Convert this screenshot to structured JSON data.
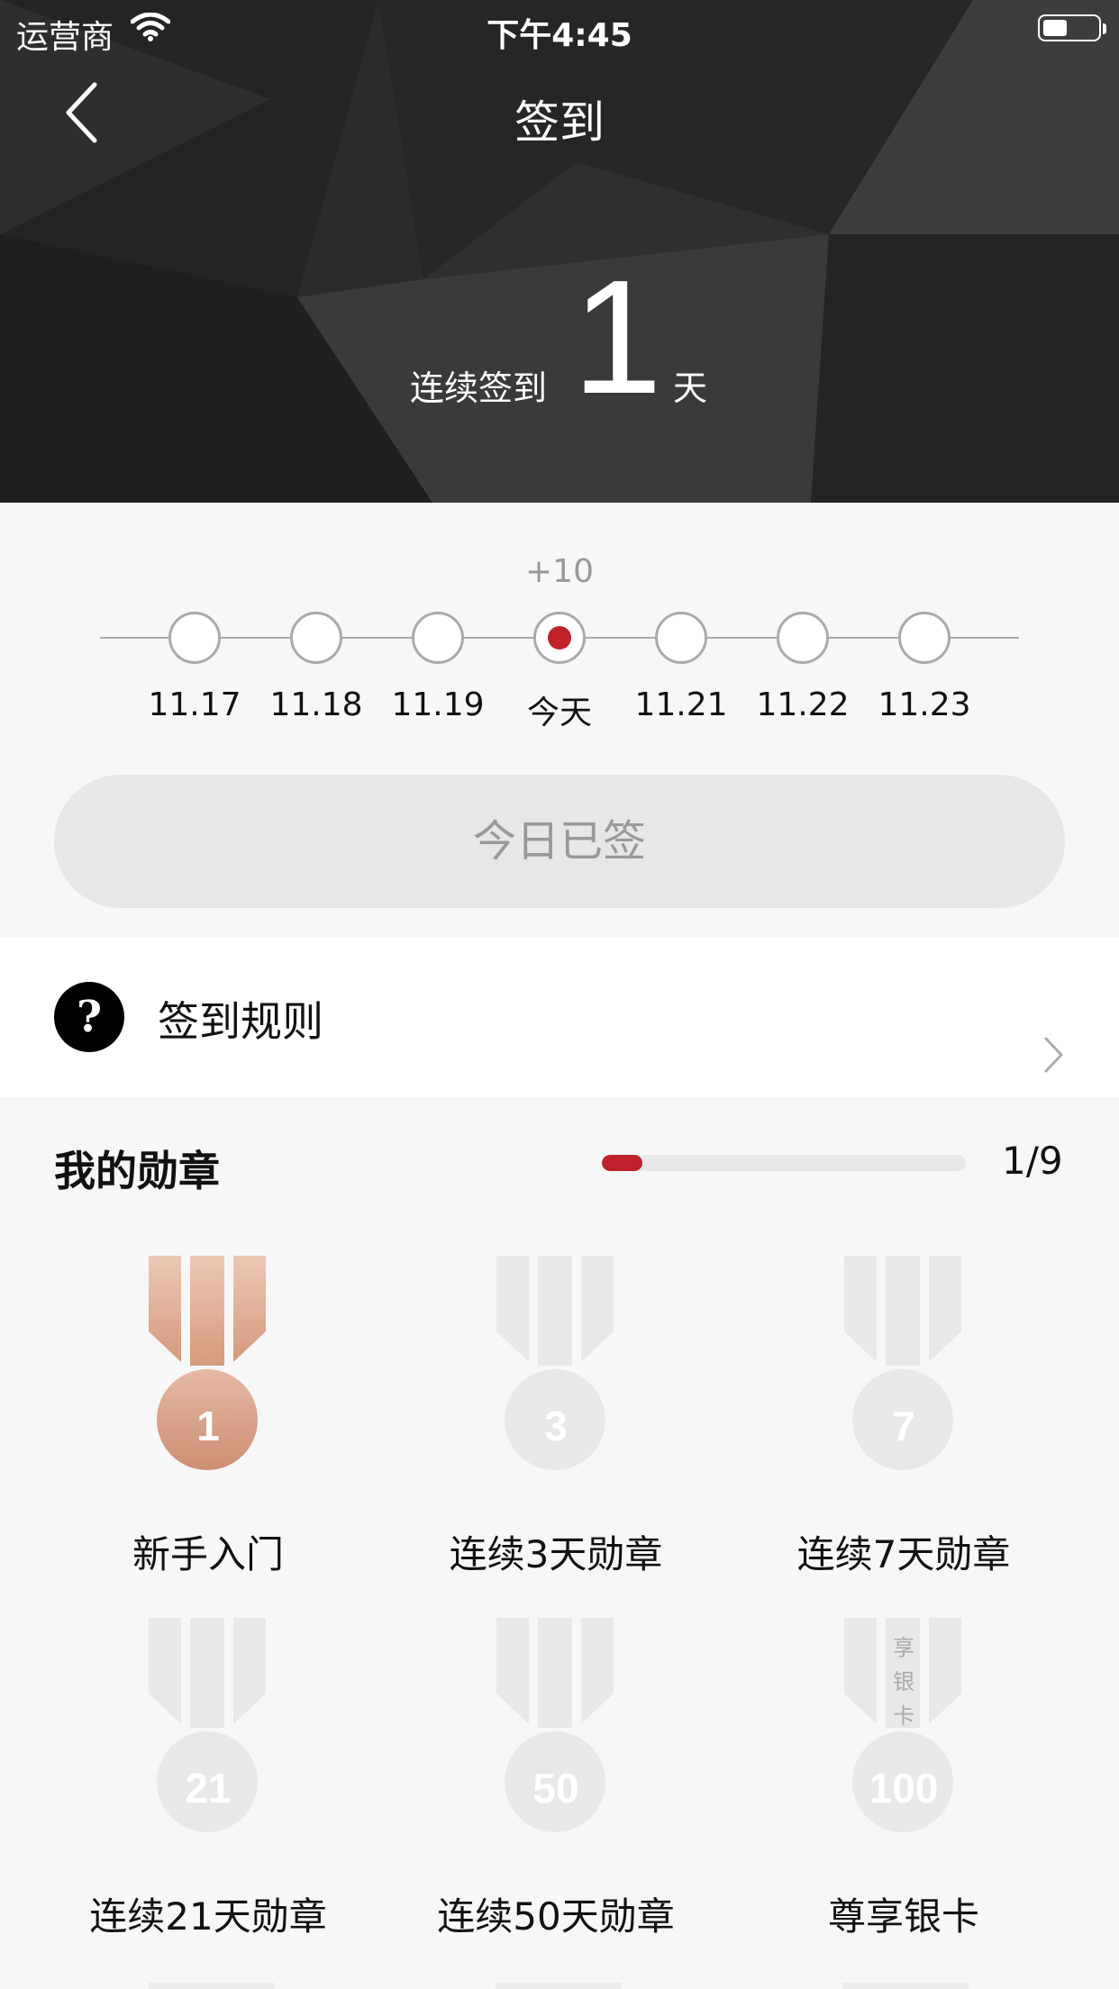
{
  "status_bar": {
    "carrier": "运营商",
    "time": "下午4:45"
  },
  "header": {
    "title": "签到",
    "streak_prefix": "连续签到",
    "streak_days": "1",
    "streak_suffix": "天"
  },
  "checkin": {
    "bonus": "+10",
    "days": [
      {
        "label": "11.17",
        "today": false
      },
      {
        "label": "11.18",
        "today": false
      },
      {
        "label": "11.19",
        "today": false
      },
      {
        "label": "今天",
        "today": true
      },
      {
        "label": "11.21",
        "today": false
      },
      {
        "label": "11.22",
        "today": false
      },
      {
        "label": "11.23",
        "today": false
      }
    ],
    "button_label": "今日已签"
  },
  "rules": {
    "icon": "question-icon",
    "label": "签到规则"
  },
  "medals": {
    "title": "我的勋章",
    "progress_count": "1/9",
    "progress_fraction": 0.111,
    "accent_color": "#c0222b",
    "earned_color": "#d9a58c",
    "locked_color": "#e8e8e8",
    "items": [
      {
        "number": "1",
        "label": "新手入门",
        "earned": true
      },
      {
        "number": "3",
        "label": "连续3天勋章",
        "earned": false
      },
      {
        "number": "7",
        "label": "连续7天勋章",
        "earned": false
      },
      {
        "number": "21",
        "label": "连续21天勋章",
        "earned": false
      },
      {
        "number": "50",
        "label": "连续50天勋章",
        "earned": false
      },
      {
        "number": "100",
        "label": "尊享银卡",
        "earned": false,
        "ribbon_text": "享银卡"
      }
    ]
  }
}
